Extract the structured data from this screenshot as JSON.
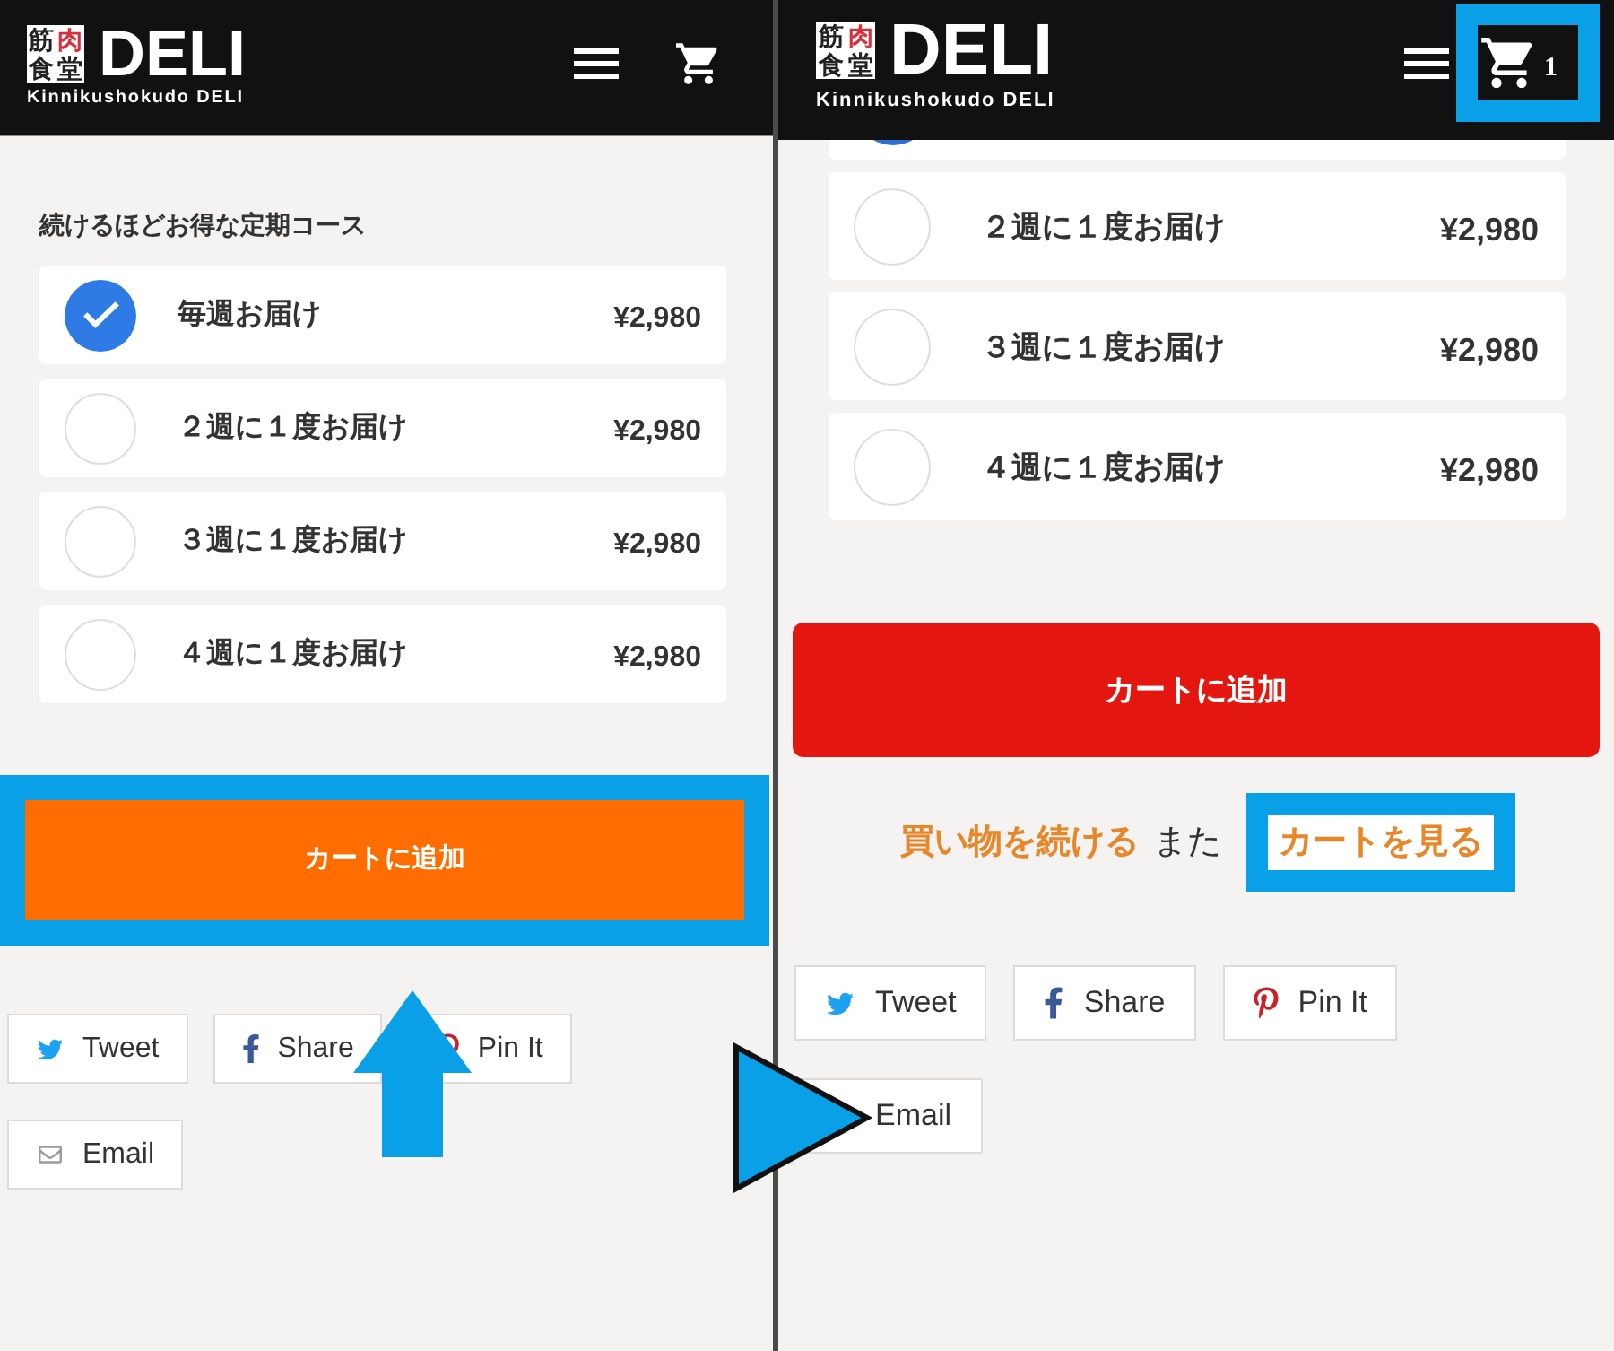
{
  "panels": [
    {
      "header": {
        "logo_mark": [
          {
            "char": "筋",
            "color": "#222222"
          },
          {
            "char": "肉",
            "color": "#d9303e"
          },
          {
            "char": "食",
            "color": "#222222"
          },
          {
            "char": "堂",
            "color": "#222222"
          }
        ],
        "logo_text": "DELI",
        "tagline": "Kinnikushokudo DELI",
        "cart": {
          "highlighted": false
        }
      },
      "course_title": "続けるほどお得な定期コース",
      "options": [
        {
          "label": "毎週お届け",
          "price": "¥2,980",
          "checked": true
        },
        {
          "label": "２週に１度お届け",
          "price": "¥2,980",
          "checked": false
        },
        {
          "label": "３週に１度お届け",
          "price": "¥2,980",
          "checked": false
        },
        {
          "label": "４週に１度お届け",
          "price": "¥2,980",
          "checked": false
        }
      ],
      "add_to_cart": {
        "label": "カートに追加",
        "color": "#ff6d00",
        "highlighted": true
      },
      "share": [
        {
          "kind": "twitter",
          "label": "Tweet"
        },
        {
          "kind": "facebook",
          "label": "Share"
        },
        {
          "kind": "pinterest",
          "label": "Pin It"
        },
        {
          "kind": "email",
          "label": "Email"
        }
      ],
      "annotation": {
        "kind": "arrow_up"
      }
    },
    {
      "header": {
        "logo_mark": [
          {
            "char": "筋",
            "color": "#222222"
          },
          {
            "char": "肉",
            "color": "#d9303e"
          },
          {
            "char": "食",
            "color": "#222222"
          },
          {
            "char": "堂",
            "color": "#222222"
          }
        ],
        "logo_text": "DELI",
        "tagline": "Kinnikushokudo DELI",
        "cart": {
          "highlighted": true,
          "count": "1"
        }
      },
      "options": [
        {
          "kind": "cut_off",
          "checked": true
        },
        {
          "kind": "full",
          "label": "２週に１度お届け",
          "price": "¥2,980",
          "checked": false
        },
        {
          "kind": "full",
          "label": "３週に１度お届け",
          "price": "¥2,980",
          "checked": false
        },
        {
          "kind": "full",
          "label": "４週に１度お届け",
          "price": "¥2,980",
          "checked": false
        }
      ],
      "add_to_cart": {
        "label": "カートに追加",
        "color": "#e3170f",
        "highlighted": false
      },
      "continue": {
        "continue_link": "買い物を続ける",
        "or_text": "また",
        "cart_link": "カートを見る",
        "cart_link_highlighted": true
      },
      "share": [
        {
          "kind": "twitter",
          "label": "Tweet"
        },
        {
          "kind": "facebook",
          "label": "Share"
        },
        {
          "kind": "pinterest",
          "label": "Pin It"
        },
        {
          "kind": "email",
          "label": "Email"
        }
      ],
      "annotation": {
        "kind": "triangle"
      }
    }
  ]
}
